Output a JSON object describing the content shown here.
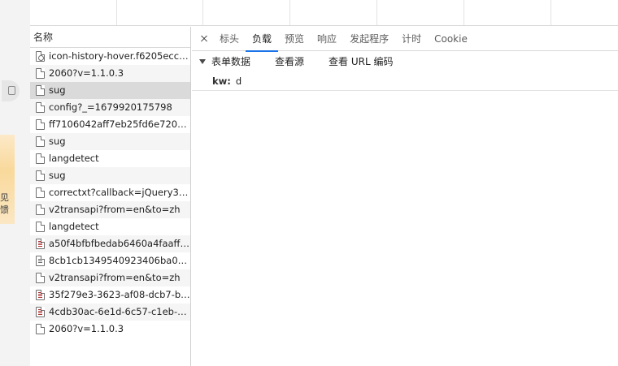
{
  "page_strip": {
    "ad_text": [
      "见",
      "馈"
    ]
  },
  "request_list": {
    "header": "名称",
    "rows": [
      {
        "name": "icon-history-hover.f6205ecc.p...",
        "icon": "image-file-icon",
        "state": "normal"
      },
      {
        "name": "2060?v=1.1.0.3",
        "icon": "document-file-icon",
        "state": "alt"
      },
      {
        "name": "sug",
        "icon": "document-file-icon",
        "state": "selected"
      },
      {
        "name": "config?_=1679920175798",
        "icon": "document-file-icon",
        "state": "alt"
      },
      {
        "name": "ff7106042aff7eb25fd6e72025f...",
        "icon": "document-file-icon",
        "state": "normal"
      },
      {
        "name": "sug",
        "icon": "document-file-icon",
        "state": "alt"
      },
      {
        "name": "langdetect",
        "icon": "document-file-icon",
        "state": "normal"
      },
      {
        "name": "sug",
        "icon": "document-file-icon",
        "state": "alt"
      },
      {
        "name": "correctxt?callback=jQuery321...",
        "icon": "document-file-icon",
        "state": "normal"
      },
      {
        "name": "v2transapi?from=en&to=zh",
        "icon": "document-file-icon",
        "state": "alt"
      },
      {
        "name": "langdetect",
        "icon": "document-file-icon",
        "state": "normal"
      },
      {
        "name": "a50f4bfbfbedab6460a4faaff83...",
        "icon": "script-file-icon",
        "state": "alt"
      },
      {
        "name": "8cb1cb1349540923406ba094...",
        "icon": "stylesheet-file-icon",
        "state": "normal"
      },
      {
        "name": "v2transapi?from=en&to=zh",
        "icon": "document-file-icon",
        "state": "alt"
      },
      {
        "name": "35f279e3-3623-af08-dcb7-bd...",
        "icon": "script-file-icon",
        "state": "normal"
      },
      {
        "name": "4cdb30ac-6e1d-6c57-c1eb-8b...",
        "icon": "script-file-icon",
        "state": "alt"
      },
      {
        "name": "2060?v=1.1.0.3",
        "icon": "document-file-icon",
        "state": "normal"
      }
    ]
  },
  "detail": {
    "tabs": [
      {
        "label": "标头",
        "active": false
      },
      {
        "label": "负载",
        "active": true
      },
      {
        "label": "预览",
        "active": false
      },
      {
        "label": "响应",
        "active": false
      },
      {
        "label": "发起程序",
        "active": false
      },
      {
        "label": "计时",
        "active": false
      },
      {
        "label": "Cookie",
        "active": false
      }
    ],
    "section_title": "表单数据",
    "view_source": "查看源",
    "view_url_encoded": "查看 URL 编码",
    "params": [
      {
        "key": "kw:",
        "value": "d"
      }
    ]
  },
  "colors": {
    "active_tab_underline": "#1a73e8",
    "selected_row": "#dadada",
    "alt_row": "#f5f5f5"
  }
}
